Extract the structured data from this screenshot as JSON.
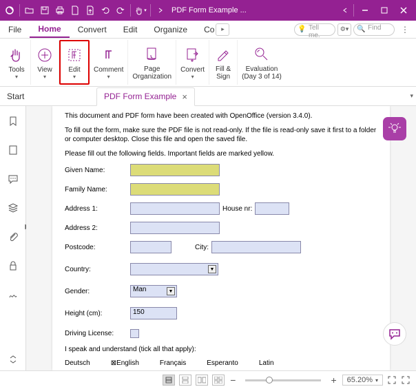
{
  "titlebar": {
    "title": "PDF Form Example ..."
  },
  "menu": {
    "items": [
      "File",
      "Home",
      "Convert",
      "Edit",
      "Organize",
      "Co"
    ],
    "active": 1,
    "tellme_placeholder": "Tell me.",
    "find_placeholder": "Find"
  },
  "ribbon": {
    "tools": "Tools",
    "view": "View",
    "edit": "Edit",
    "comment": "Comment",
    "page_org": "Page\nOrganization",
    "convert": "Convert",
    "fill_sign": "Fill &\nSign",
    "evaluation": "Evaluation\n(Day 3 of 14)"
  },
  "tabs": {
    "start": "Start",
    "doc": "PDF Form Example"
  },
  "doc": {
    "intro1": "This document and PDF form have been created with OpenOffice (version 3.4.0).",
    "intro2": "To fill out the form, make sure the PDF file is not read-only. If the file is read-only save it first to a folder or computer desktop. Close this file and open the saved file.",
    "intro3": "Please fill out the following fields. Important fields are marked yellow.",
    "labels": {
      "given": "Given Name:",
      "family": "Family Name:",
      "addr1": "Address 1:",
      "addr2": "Address 2:",
      "house": "House nr:",
      "postcode": "Postcode:",
      "city": "City:",
      "country": "Country:",
      "gender": "Gender:",
      "height": "Height (cm):",
      "driving": "Driving License:",
      "langs_intro": "I speak and understand (tick all that apply):"
    },
    "values": {
      "gender": "Man",
      "height": "150"
    },
    "langs": [
      "Deutsch",
      "English",
      "Français",
      "Esperanto",
      "Latin"
    ],
    "langs_checked": [
      false,
      true,
      false,
      false,
      false
    ]
  },
  "status": {
    "zoom": "65.20%"
  },
  "colors": {
    "brand": "#942192"
  }
}
